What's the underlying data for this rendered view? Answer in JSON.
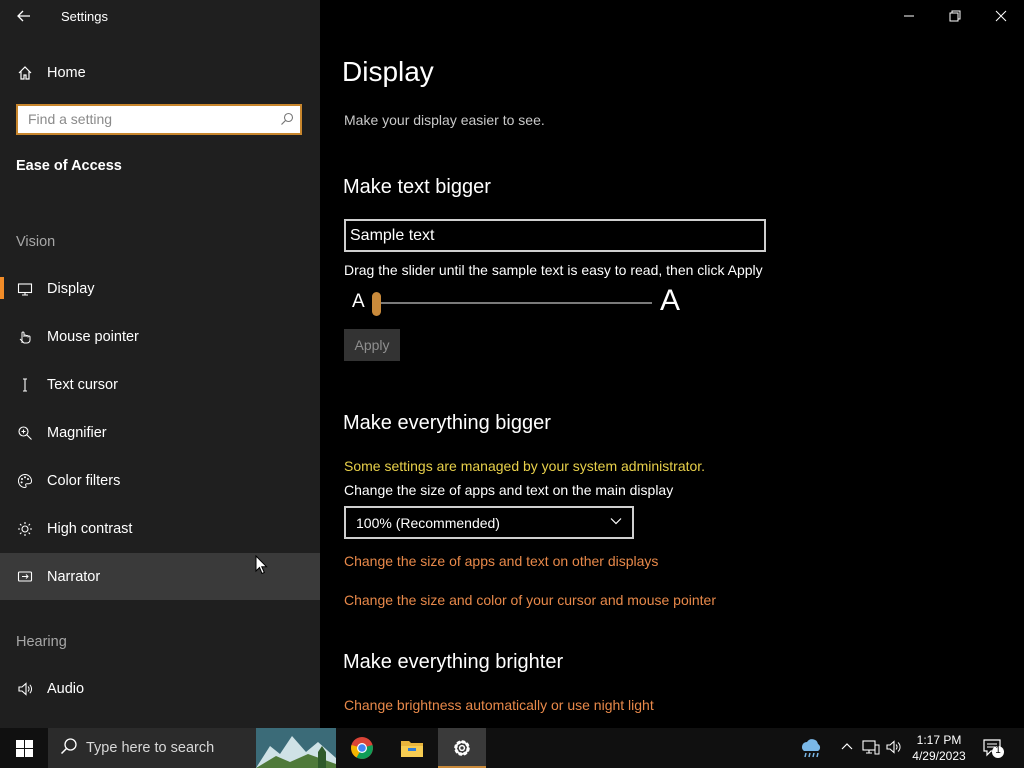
{
  "window": {
    "title": "Settings"
  },
  "sidebar": {
    "home_label": "Home",
    "search_placeholder": "Find a setting",
    "section_title": "Ease of Access",
    "groups": {
      "vision": "Vision",
      "hearing": "Hearing"
    },
    "items": [
      {
        "label": "Display",
        "icon": "monitor-icon"
      },
      {
        "label": "Mouse pointer",
        "icon": "mouse-pointer-icon"
      },
      {
        "label": "Text cursor",
        "icon": "text-cursor-icon"
      },
      {
        "label": "Magnifier",
        "icon": "magnifier-icon"
      },
      {
        "label": "Color filters",
        "icon": "palette-icon"
      },
      {
        "label": "High contrast",
        "icon": "sun-icon"
      },
      {
        "label": "Narrator",
        "icon": "narrator-icon"
      },
      {
        "label": "Audio",
        "icon": "speaker-icon"
      }
    ]
  },
  "main": {
    "title": "Display",
    "subtitle": "Make your display easier to see.",
    "text_bigger": {
      "heading": "Make text bigger",
      "sample_text": "Sample text",
      "hint": "Drag the slider until the sample text is easy to read, then click Apply",
      "small_a": "A",
      "large_a": "A",
      "slider_value_percent": 0,
      "apply_label": "Apply"
    },
    "everything_bigger": {
      "heading": "Make everything bigger",
      "admin_note": "Some settings are managed by your system administrator.",
      "size_label": "Change the size of apps and text on the main display",
      "size_value": "100% (Recommended)",
      "link_other_displays": "Change the size of apps and text on other displays",
      "link_cursor": "Change the size and color of your cursor and mouse pointer"
    },
    "everything_brighter": {
      "heading": "Make everything brighter",
      "link_brightness": "Change brightness automatically or use night light"
    }
  },
  "taskbar": {
    "search_placeholder": "Type here to search",
    "clock_time": "1:17 PM",
    "clock_date": "4/29/2023",
    "notification_count": "1"
  },
  "colors": {
    "accent": "#f28c28",
    "link": "#e8894a",
    "warning": "#e8d04a",
    "sidebar_bg": "#1f1f1f"
  }
}
